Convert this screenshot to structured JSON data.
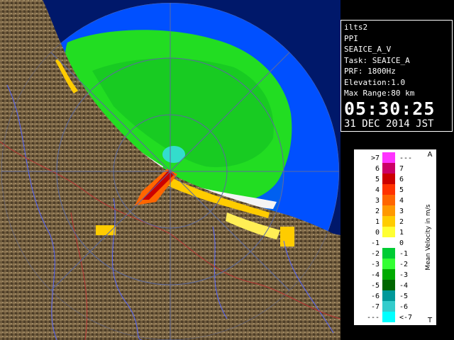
{
  "info": {
    "site": "ilts2",
    "scan_type": "PPI",
    "product": "SEAICE_A_V",
    "task": "Task: SEAICE_A",
    "prf": "PRF: 1800Hz",
    "elevation": "Elevation:1.0",
    "max_range": "Max Range:80 km",
    "time": "05:30:25",
    "date": "31 DEC 2014 JST"
  },
  "legend": {
    "title": "Mean Velocity in m/s",
    "top_marker": "A",
    "bottom_marker": "T",
    "left_labels": [
      ">7",
      "6",
      "5",
      "4",
      "3",
      "2",
      "1",
      "0",
      "-1",
      "-2",
      "-3",
      "-4",
      "-5",
      "-6",
      "-7",
      "---"
    ],
    "right_labels": [
      "---",
      "7",
      "6",
      "5",
      "4",
      "3",
      "2",
      "1",
      "0",
      "-1",
      "-2",
      "-3",
      "-4",
      "-5",
      "-6",
      "<-7"
    ],
    "colors": [
      "#ff33ff",
      "#cc0066",
      "#cc0000",
      "#ff3300",
      "#ff6600",
      "#ff9900",
      "#ffcc00",
      "#ffff33",
      "#ffffff",
      "#00cc33",
      "#33ff33",
      "#00aa00",
      "#006600",
      "#009999",
      "#33cccc",
      "#00ffff"
    ]
  },
  "colors": {
    "sea_far": "#0050ff",
    "sea_near": "#0066ee",
    "land": "#6e5a3c",
    "echo_green": "#22dd22",
    "range_ring": "#5c6aa0"
  }
}
